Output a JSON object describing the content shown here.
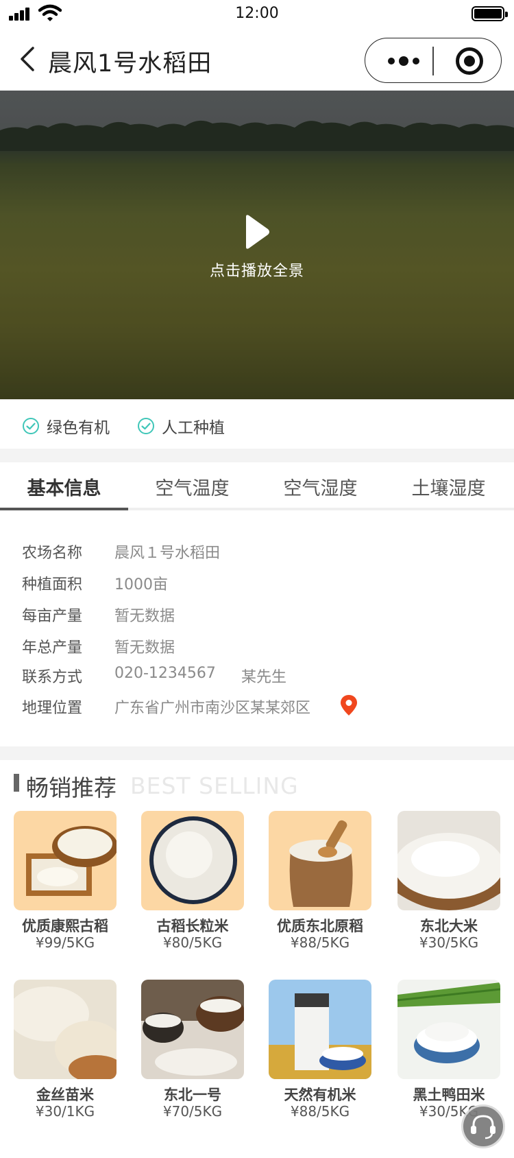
{
  "status_bar": {
    "time": "12:00"
  },
  "nav": {
    "title": "晨风1号水稻田"
  },
  "hero": {
    "play_label": "点击播放全景"
  },
  "tags": [
    "绿色有机",
    "人工种植"
  ],
  "tabs": [
    {
      "label": "基本信息",
      "active": true
    },
    {
      "label": "空气温度",
      "active": false
    },
    {
      "label": "空气湿度",
      "active": false
    },
    {
      "label": "土壤湿度",
      "active": false
    }
  ],
  "info": [
    {
      "key": "农场名称",
      "value": "晨风１号水稻田"
    },
    {
      "key": "种植面积",
      "value": "1000亩"
    },
    {
      "key": "每亩产量",
      "value": "暂无数据"
    },
    {
      "key": "年总产量",
      "value": "暂无数据"
    },
    {
      "key": "联系方式",
      "value": "020-1234567",
      "contact": "某先生"
    },
    {
      "key": "地理位置",
      "value": "广东省广州市南沙区某某郊区"
    }
  ],
  "best_selling": {
    "title": "畅销推荐",
    "subtitle": "BEST SELLING",
    "products": [
      {
        "name": "优质康熙古稻",
        "price": "¥99/5KG"
      },
      {
        "name": "古稻长粒米",
        "price": "¥80/5KG"
      },
      {
        "name": "优质东北原稻",
        "price": "¥88/5KG"
      },
      {
        "name": "东北大米",
        "price": "¥30/5KG"
      },
      {
        "name": "金丝苗米",
        "price": "¥30/1KG"
      },
      {
        "name": "东北一号",
        "price": "¥70/5KG"
      },
      {
        "name": "天然有机米",
        "price": "¥88/5KG"
      },
      {
        "name": "黑土鸭田米",
        "price": "¥30/5KG"
      }
    ]
  },
  "colors": {
    "accent_check": "#3fc6b8",
    "pin": "#f0471e",
    "peach_bg": "#fcd7a4"
  },
  "icons": [
    "signal-icon",
    "wifi-icon",
    "battery-icon",
    "back-icon",
    "more-icon",
    "target-icon",
    "play-icon",
    "check-icon",
    "location-pin-icon",
    "customer-service-icon"
  ]
}
